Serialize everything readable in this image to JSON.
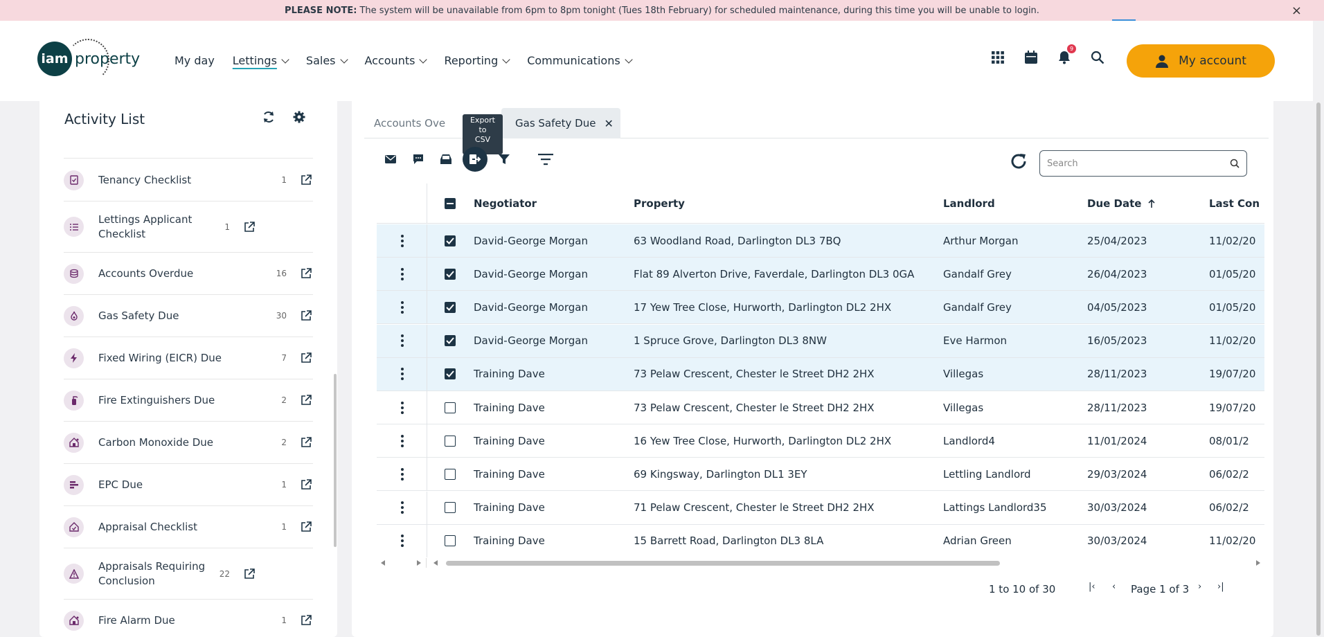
{
  "banner": {
    "prefix": "PLEASE NOTE:",
    "text": "The system will be unavailable from 6pm to 8pm tonight (Tues 18th February) for scheduled maintenance, during this time you will be unable to login.",
    "close": "×"
  },
  "logo": {
    "circle": "iam",
    "text": "property"
  },
  "nav": [
    {
      "label": "My day",
      "has_menu": false
    },
    {
      "label": "Lettings",
      "has_menu": true,
      "active": true
    },
    {
      "label": "Sales",
      "has_menu": true
    },
    {
      "label": "Accounts",
      "has_menu": true
    },
    {
      "label": "Reporting",
      "has_menu": true
    },
    {
      "label": "Communications",
      "has_menu": true
    }
  ],
  "header_icons": {
    "notification_count": "9"
  },
  "account_button": "My account",
  "activity_panel": {
    "title": "Activity List",
    "items": [
      {
        "label": "Tenancy Checklist",
        "count": "1",
        "icon": "checklist-doc-icon"
      },
      {
        "label": "Lettings Applicant Checklist",
        "count": "1",
        "icon": "list-check-icon"
      },
      {
        "label": "Accounts Overdue",
        "count": "16",
        "icon": "coins-icon"
      },
      {
        "label": "Gas Safety Due",
        "count": "30",
        "icon": "flame-icon"
      },
      {
        "label": "Fixed Wiring (EICR) Due",
        "count": "7",
        "icon": "bolt-icon"
      },
      {
        "label": "Fire Extinguishers Due",
        "count": "2",
        "icon": "extinguisher-icon"
      },
      {
        "label": "Carbon Monoxide Due",
        "count": "2",
        "icon": "house-alarm-icon"
      },
      {
        "label": "EPC Due",
        "count": "1",
        "icon": "bars-icon"
      },
      {
        "label": "Appraisal Checklist",
        "count": "1",
        "icon": "house-check-icon"
      },
      {
        "label": "Appraisals Requiring Conclusion",
        "count": "22",
        "icon": "warning-icon"
      },
      {
        "label": "Fire Alarm Due",
        "count": "1",
        "icon": "house-alarm-icon"
      }
    ]
  },
  "tabs": {
    "first": "Accounts Ove",
    "second": "Gas Safety Due",
    "tooltip": [
      "Export",
      "to",
      "CSV"
    ]
  },
  "search": {
    "placeholder": "Search",
    "value": ""
  },
  "grid": {
    "columns": [
      "Negotiator",
      "Property",
      "Landlord",
      "Due Date",
      "Last Con"
    ],
    "sort_column": "Due Date",
    "rows": [
      {
        "selected": true,
        "negotiator": "David-George Morgan",
        "property": "63 Woodland Road, Darlington DL3 7BQ",
        "landlord": "Arthur Morgan",
        "due": "25/04/2023",
        "last": "11/02/20"
      },
      {
        "selected": true,
        "negotiator": "David-George Morgan",
        "property": "Flat 89 Alverton Drive, Faverdale, Darlington DL3 0GA",
        "landlord": "Gandalf Grey",
        "due": "26/04/2023",
        "last": "01/05/20"
      },
      {
        "selected": true,
        "negotiator": "David-George Morgan",
        "property": "17 Yew Tree Close, Hurworth, Darlington DL2 2HX",
        "landlord": "Gandalf Grey",
        "due": "04/05/2023",
        "last": "01/05/20"
      },
      {
        "selected": true,
        "negotiator": "David-George Morgan",
        "property": "1 Spruce Grove, Darlington DL3 8NW",
        "landlord": "Eve Harmon",
        "due": "16/05/2023",
        "last": "11/02/20"
      },
      {
        "selected": true,
        "negotiator": "Training Dave",
        "property": "73 Pelaw Crescent, Chester le Street DH2 2HX",
        "landlord": "Villegas",
        "due": "28/11/2023",
        "last": "19/07/20"
      },
      {
        "selected": false,
        "negotiator": "Training Dave",
        "property": "73 Pelaw Crescent, Chester le Street DH2 2HX",
        "landlord": "Villegas",
        "due": "28/11/2023",
        "last": "19/07/20"
      },
      {
        "selected": false,
        "negotiator": "Training Dave",
        "property": "16 Yew Tree Close, Hurworth, Darlington DL2 2HX",
        "landlord": "Landlord4",
        "due": "11/01/2024",
        "last": "08/01/2"
      },
      {
        "selected": false,
        "negotiator": "Training Dave",
        "property": "69 Kingsway, Darlington DL1 3EY",
        "landlord": "Lettling Landlord",
        "due": "29/03/2024",
        "last": "06/02/2"
      },
      {
        "selected": false,
        "negotiator": "Training Dave",
        "property": "71 Pelaw Crescent, Chester le Street DH2 2HX",
        "landlord": "Lattings Landlord35",
        "due": "30/03/2024",
        "last": "06/02/2"
      },
      {
        "selected": false,
        "negotiator": "Training Dave",
        "property": "15 Barrett Road, Darlington DL3 8LA",
        "landlord": "Adrian Green",
        "due": "30/03/2024",
        "last": "11/02/20"
      }
    ]
  },
  "pager": {
    "range": "1 to 10 of 30",
    "page": "Page 1 of 3"
  },
  "colors": {
    "accent": "#f5a30a",
    "dark": "#1d3445",
    "selected_row": "#e8f4fb",
    "banner": "#f7d9de"
  }
}
